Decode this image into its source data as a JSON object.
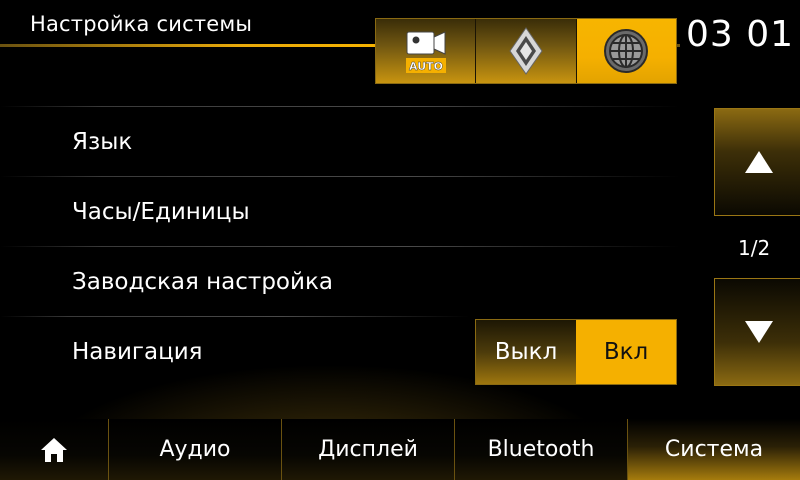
{
  "header": {
    "title": "Настройка системы",
    "clock": "03 01"
  },
  "mode_tabs": [
    {
      "icon": "camera-auto-icon",
      "label": "AUTO",
      "active": false
    },
    {
      "icon": "renault-logo-icon",
      "active": false
    },
    {
      "icon": "globe-icon",
      "active": true
    }
  ],
  "menu": {
    "items": [
      {
        "label": "Язык"
      },
      {
        "label": "Часы/Единицы"
      },
      {
        "label": "Заводская настройка"
      },
      {
        "label": "Навигация"
      }
    ],
    "navigation_toggle": {
      "off_label": "Выкл",
      "on_label": "Вкл",
      "selected": "on"
    }
  },
  "pagination": {
    "page": "1/2"
  },
  "bottom_tabs": [
    {
      "icon": "home-icon",
      "label": ""
    },
    {
      "label": "Аудио"
    },
    {
      "label": "Дисплей"
    },
    {
      "label": "Bluetooth"
    },
    {
      "label": "Система",
      "active": true
    }
  ],
  "colors": {
    "accent": "#f5b000",
    "background": "#000000",
    "text": "#ffffff"
  }
}
